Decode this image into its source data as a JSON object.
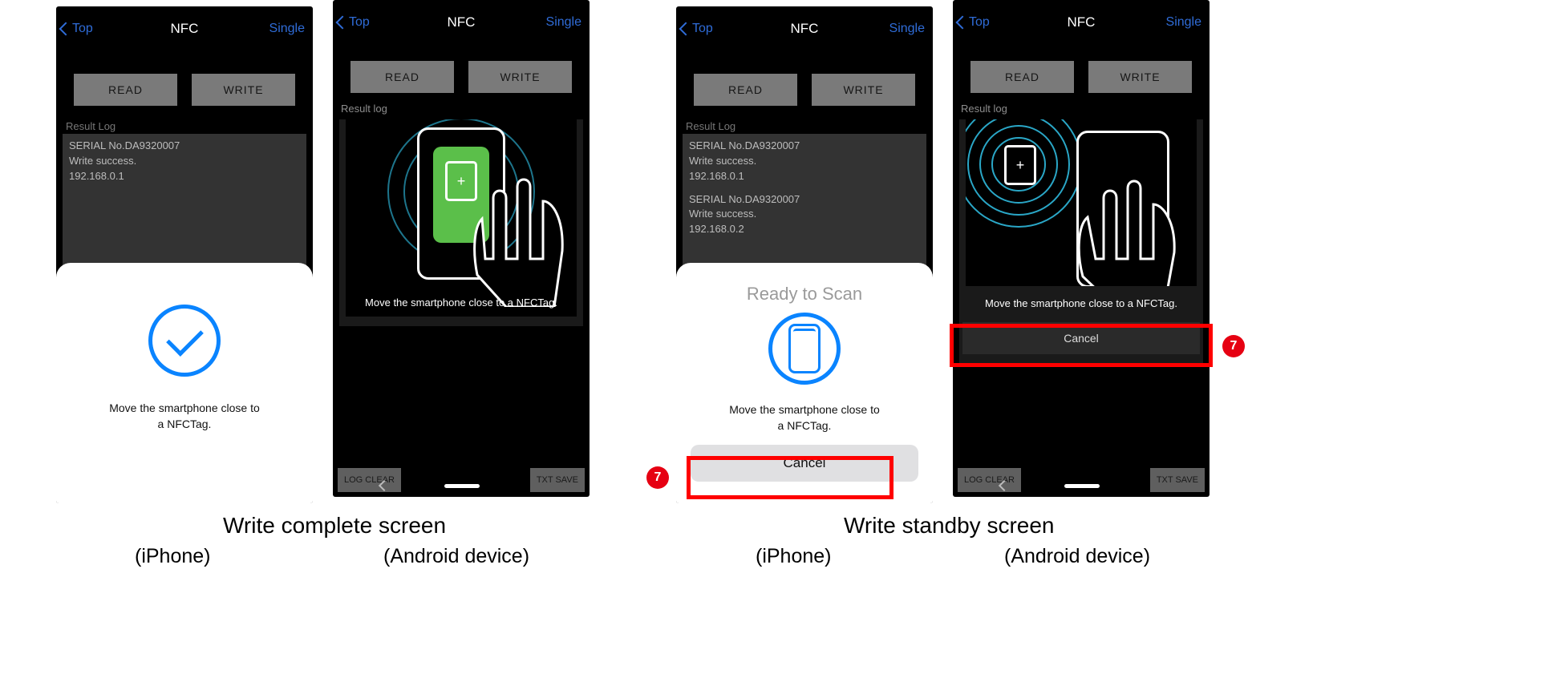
{
  "nav": {
    "back": "Top",
    "title": "NFC",
    "right": "Single"
  },
  "buttons": {
    "read": "READ",
    "write": "WRITE",
    "log_clear": "LOG CLEAR",
    "txt_save": "TXT SAVE",
    "cancel": "Cancel"
  },
  "labels": {
    "result_ios": "Result Log",
    "result_and": "Result log"
  },
  "msgs": {
    "move_2line_a": "Move the smartphone close to",
    "move_2line_b": "a NFCTag.",
    "move_1line": "Move the smartphone close to a NFCTag.",
    "ready": "Ready to Scan"
  },
  "log1": {
    "l1": "SERIAL No.DA9320007",
    "l2": "Write success.",
    "l3": "192.168.0.1"
  },
  "log2": {
    "l1": "SERIAL No.DA9320007",
    "l2": "Write success.",
    "l3": "192.168.0.1",
    "l4": "SERIAL No.DA9320007",
    "l5": "Write success.",
    "l6": "192.168.0.2"
  },
  "captions": {
    "complete": "Write complete screen",
    "standby": "Write standby screen",
    "iphone": "(iPhone)",
    "android": "(Android device)"
  },
  "callout": {
    "num": "7"
  }
}
